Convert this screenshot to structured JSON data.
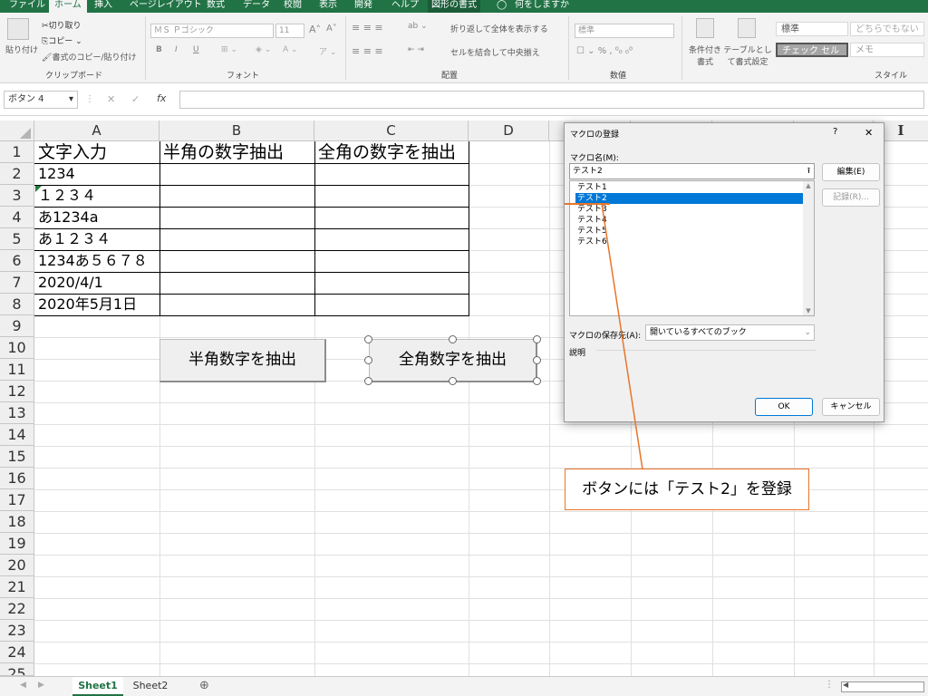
{
  "menubar": {
    "tabs": [
      "ファイル",
      "ホーム",
      "挿入",
      "ページレイアウト",
      "数式",
      "データ",
      "校閲",
      "表示",
      "開発",
      "ヘルプ",
      "図形の書式"
    ],
    "tell_me": "何をしますか"
  },
  "ribbon": {
    "clipboard": {
      "paste": "貼り付け",
      "cut": "切り取り",
      "copy": "コピー",
      "format_painter": "書式のコピー/貼り付け",
      "label": "クリップボード"
    },
    "font": {
      "font_name": "ＭＳ Ｐゴシック",
      "font_size": "11",
      "label": "フォント"
    },
    "alignment": {
      "wrap": "折り返して全体を表示する",
      "merge": "セルを結合して中央揃え",
      "label": "配置"
    },
    "number": {
      "format": "標準",
      "label": "数値"
    },
    "styles": {
      "conditional": "条件付き書式",
      "table": "テーブルとして書式設定",
      "standard": "標準",
      "neither": "どちらでもない",
      "check_cell": "チェック セル",
      "memo": "メモ",
      "label": "スタイル"
    }
  },
  "formula_bar": {
    "name_box": "ボタン 4",
    "fx": "fx",
    "cancel": "✕",
    "enter": "✓"
  },
  "columns": [
    "A",
    "B",
    "C",
    "D"
  ],
  "rows": [
    "1",
    "2",
    "3",
    "4",
    "5",
    "6",
    "7",
    "8",
    "9",
    "10",
    "11",
    "12",
    "13",
    "14",
    "15",
    "16",
    "17",
    "18",
    "19",
    "20",
    "21",
    "22",
    "23",
    "24",
    "25"
  ],
  "table": {
    "headers": [
      "文字入力",
      "半角の数字抽出",
      "全角の数字を抽出"
    ],
    "values": [
      "1234",
      "１２３４",
      "あ1234a",
      "あ１２３４",
      "1234あ５６７８",
      "2020/4/1",
      "2020年5月1日"
    ]
  },
  "buttons": {
    "half": "半角数字を抽出",
    "full": "全角数字を抽出"
  },
  "dialog": {
    "title": "マクロの登録",
    "help": "?",
    "close": "✕",
    "macro_name_label": "マクロ名(M):",
    "macro_name_value": "テスト2",
    "macros": [
      "テスト1",
      "テスト2",
      "テスト3",
      "テスト4",
      "テスト5",
      "テスト6"
    ],
    "selected_index": 1,
    "edit_button": "編集(E)",
    "record_button": "記録(R)...",
    "store_label": "マクロの保存先(A):",
    "store_value": "開いているすべてのブック",
    "description_label": "説明",
    "ok_button": "OK",
    "cancel_button": "キャンセル"
  },
  "callout": "ボタンには「テスト2」を登録",
  "sheets": {
    "active": "Sheet1",
    "other": "Sheet2",
    "add": "⊕"
  },
  "colors": {
    "excel_green": "#217346",
    "callout_orange": "#e8752a",
    "selection_blue": "#0078d7"
  }
}
